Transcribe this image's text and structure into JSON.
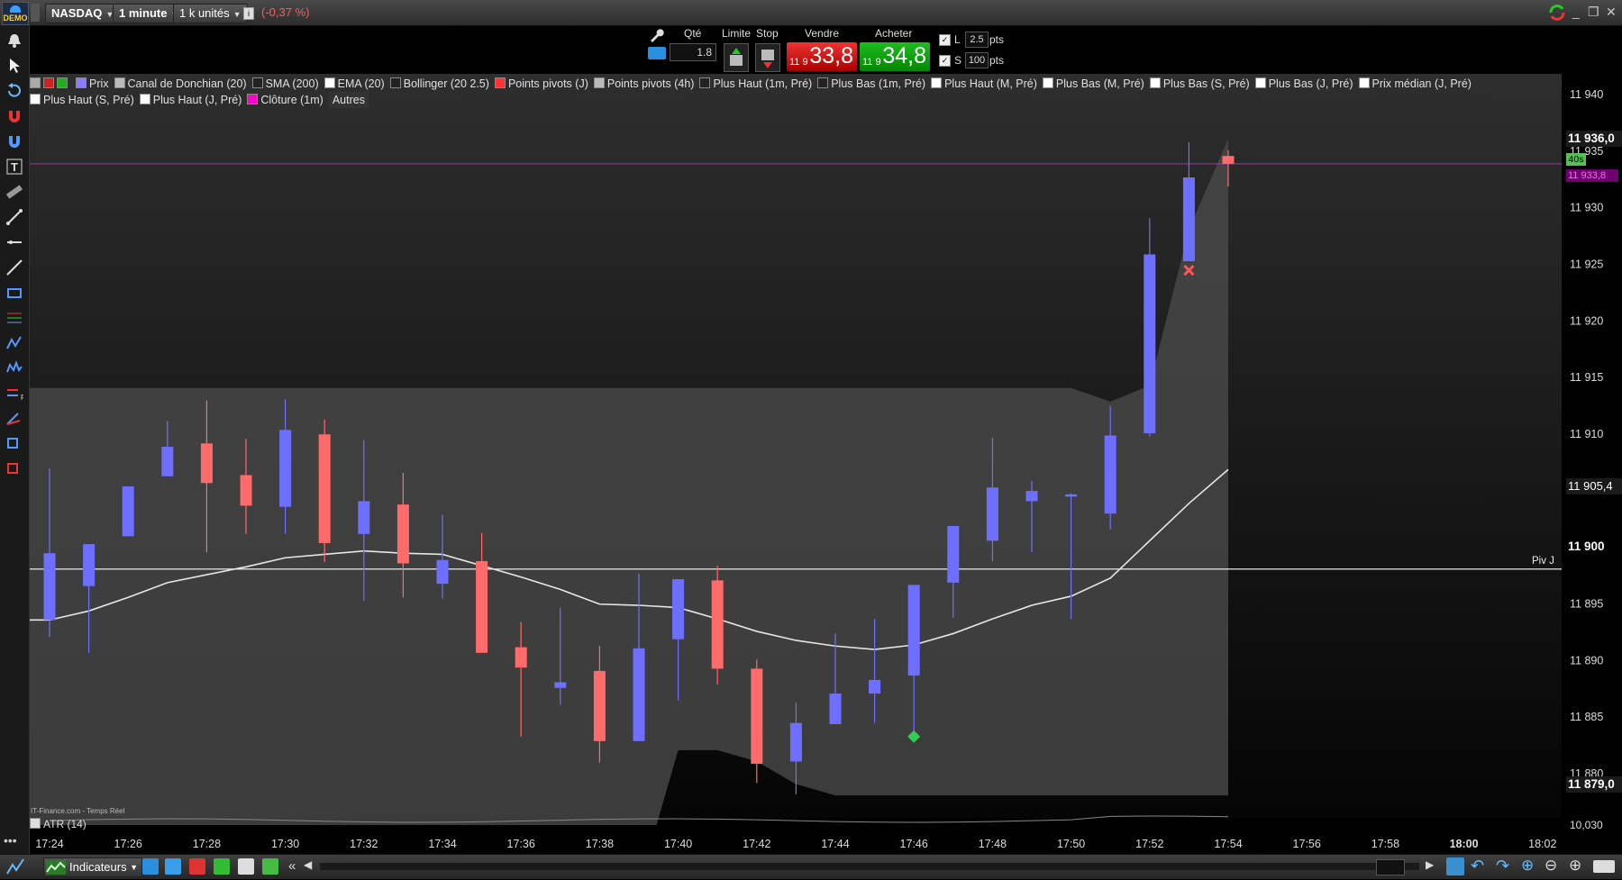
{
  "topbar": {
    "demo_label": "DEMO",
    "instrument": "NASDAQ",
    "timeframe": "1 minute",
    "units": "1 k unités",
    "change": "(-0,37 %)"
  },
  "order_panel": {
    "qty_label": "Qté",
    "qty_value": "1.8",
    "limit_label": "Limite",
    "stop_label": "Stop",
    "sell_label": "Vendre",
    "buy_label": "Acheter",
    "sell_prefix": "11 9",
    "sell_price": "33,8",
    "buy_prefix": "11 9",
    "buy_price": "34,8",
    "l_label": "L",
    "l_value": "2.5",
    "l_unit": "pts",
    "s_label": "S",
    "s_value": "100",
    "s_unit": "pts"
  },
  "legend": {
    "items": [
      {
        "label": "Prix",
        "color": "#8a7dff"
      },
      {
        "label": "Canal de Donchian (20)",
        "color": "#bbbbbb"
      },
      {
        "label": "SMA (200)",
        "color": "#222222"
      },
      {
        "label": "EMA (20)",
        "color": "#ffffff"
      },
      {
        "label": "Bollinger (20 2.5)",
        "color": "#222222"
      },
      {
        "label": "Points pivots (J)",
        "color": "#ff3333"
      },
      {
        "label": "Points pivots (4h)",
        "color": "#bbbbbb"
      },
      {
        "label": "Plus Haut (1m, Pré)",
        "color": "#222222"
      },
      {
        "label": "Plus Bas (1m, Pré)",
        "color": "#222222"
      },
      {
        "label": "Plus Haut (M, Pré)",
        "color": "#ffffff"
      },
      {
        "label": "Plus Bas (M, Pré)",
        "color": "#ffffff"
      },
      {
        "label": "Plus Bas (S, Pré)",
        "color": "#ffffff"
      },
      {
        "label": "Plus Bas (J, Pré)",
        "color": "#ffffff"
      },
      {
        "label": "Prix médian (J, Pré)",
        "color": "#ffffff"
      },
      {
        "label": "Plus Haut (S, Pré)",
        "color": "#ffffff"
      },
      {
        "label": "Plus Haut (J, Pré)",
        "color": "#ffffff"
      },
      {
        "label": "Clôture (1m)",
        "color": "#ff00cc"
      },
      {
        "label": "Autres",
        "color": ""
      }
    ]
  },
  "chart": {
    "source_label": "IT-Finance.com - Temps Réel",
    "pivot_label": "Piv J",
    "timer_label": "40s",
    "close_label": "11 933,8",
    "high_label": "11 936,0",
    "low_label": "11 879,0",
    "ema_label": "11 905,4",
    "pivot_price_label": "11 900",
    "atr_label": "ATR (14)",
    "atr_value": "10,030",
    "colors": {
      "up": "#6f6fff",
      "down": "#ff6a6a",
      "channel": "#4a4a4a",
      "ema": "#e6e6e6",
      "pivot": "#ffffff",
      "close_line": "#c020c0"
    }
  },
  "chart_data": {
    "type": "candlestick",
    "title": "NASDAQ 1 minute",
    "ylim": [
      11877,
      11942
    ],
    "y_ticks": [
      "11 940",
      "11 935",
      "11 930",
      "11 925",
      "11 920",
      "11 915",
      "11 910",
      "11 905",
      "11 895",
      "11 890",
      "11 885",
      "11 880"
    ],
    "x_ticks": [
      "17:24",
      "17:26",
      "17:28",
      "17:30",
      "17:32",
      "17:34",
      "17:36",
      "17:38",
      "17:40",
      "17:42",
      "17:44",
      "17:46",
      "17:48",
      "17:50",
      "17:52",
      "17:54",
      "17:56",
      "17:58",
      "18:00",
      "18:02"
    ],
    "candles": [
      {
        "t": "17:24",
        "o": 11893.5,
        "h": 11906.9,
        "l": 11892.0,
        "c": 11899.4
      },
      {
        "t": "17:25",
        "o": 11896.5,
        "h": 11899.3,
        "l": 11890.6,
        "c": 11900.2
      },
      {
        "t": "17:26",
        "o": 11900.9,
        "h": 11895.5,
        "l": 11903.0,
        "c": 11905.3
      },
      {
        "t": "17:27",
        "o": 11906.2,
        "h": 11911.1,
        "l": 11906.3,
        "c": 11908.8
      },
      {
        "t": "17:28",
        "o": 11909.1,
        "h": 11912.9,
        "l": 11899.5,
        "c": 11905.6
      },
      {
        "t": "17:29",
        "o": 11906.3,
        "h": 11909.5,
        "l": 11901.1,
        "c": 11903.6
      },
      {
        "t": "17:30",
        "o": 11903.5,
        "h": 11913.0,
        "l": 11901.1,
        "c": 11910.3
      },
      {
        "t": "17:31",
        "o": 11909.9,
        "h": 11911.2,
        "l": 11898.6,
        "c": 11900.3
      },
      {
        "t": "17:32",
        "o": 11901.1,
        "h": 11909.4,
        "l": 11895.2,
        "c": 11904.0
      },
      {
        "t": "17:33",
        "o": 11903.7,
        "h": 11906.5,
        "l": 11895.5,
        "c": 11898.5
      },
      {
        "t": "17:34",
        "o": 11896.7,
        "h": 11902.8,
        "l": 11895.4,
        "c": 11898.8
      },
      {
        "t": "17:35",
        "o": 11898.7,
        "h": 11901.2,
        "l": 11891.2,
        "c": 11890.6
      },
      {
        "t": "17:36",
        "o": 11891.1,
        "h": 11893.3,
        "l": 11883.2,
        "c": 11889.3
      },
      {
        "t": "17:37",
        "o": 11887.5,
        "h": 11894.6,
        "l": 11886.0,
        "c": 11888.0
      },
      {
        "t": "17:38",
        "o": 11889.0,
        "h": 11891.2,
        "l": 11880.9,
        "c": 11882.8
      },
      {
        "t": "17:39",
        "o": 11882.8,
        "h": 11897.6,
        "l": 11883.3,
        "c": 11891.0
      },
      {
        "t": "17:40",
        "o": 11891.8,
        "h": 11896.3,
        "l": 11886.4,
        "c": 11897.1
      },
      {
        "t": "17:41",
        "o": 11897.0,
        "h": 11898.3,
        "l": 11887.8,
        "c": 11889.2
      },
      {
        "t": "17:42",
        "o": 11889.2,
        "h": 11890.0,
        "l": 11879.1,
        "c": 11880.8
      },
      {
        "t": "17:43",
        "o": 11881.0,
        "h": 11886.2,
        "l": 11878.1,
        "c": 11884.4
      },
      {
        "t": "17:44",
        "o": 11884.3,
        "h": 11892.3,
        "l": 11884.5,
        "c": 11887.0
      },
      {
        "t": "17:45",
        "o": 11887.0,
        "h": 11893.6,
        "l": 11884.4,
        "c": 11888.2
      },
      {
        "t": "17:46",
        "o": 11888.6,
        "h": 11896.3,
        "l": 11883.1,
        "c": 11896.6
      },
      {
        "t": "17:47",
        "o": 11896.8,
        "h": 11901.3,
        "l": 11893.7,
        "c": 11901.8
      },
      {
        "t": "17:48",
        "o": 11900.5,
        "h": 11909.6,
        "l": 11898.7,
        "c": 11905.2
      },
      {
        "t": "17:49",
        "o": 11904.0,
        "h": 11905.8,
        "l": 11899.5,
        "c": 11904.9
      },
      {
        "t": "17:50",
        "o": 11904.4,
        "h": 11904.7,
        "l": 11893.6,
        "c": 11904.6
      },
      {
        "t": "17:51",
        "o": 11902.9,
        "h": 11912.4,
        "l": 11901.5,
        "c": 11909.8
      },
      {
        "t": "17:52",
        "o": 11910.0,
        "h": 11929.0,
        "l": 11909.7,
        "c": 11925.8
      },
      {
        "t": "17:53",
        "o": 11925.2,
        "h": 11935.7,
        "l": 11925.2,
        "c": 11932.6
      },
      {
        "t": "17:54",
        "o": 11934.5,
        "h": 11935.0,
        "l": 11931.8,
        "c": 11933.8
      }
    ],
    "ema": [
      11893.5,
      11894.3,
      11895.5,
      11896.8,
      11897.5,
      11898.2,
      11899.0,
      11899.3,
      11899.6,
      11899.4,
      11899.3,
      11898.3,
      11897.3,
      11896.2,
      11894.9,
      11894.8,
      11894.6,
      11893.6,
      11892.5,
      11891.7,
      11891.2,
      11890.9,
      11891.3,
      11892.3,
      11893.6,
      11894.8,
      11895.6,
      11897.2,
      11900.5,
      11903.8,
      11906.8
    ],
    "donchian_upper": [
      11914.0,
      11914.0,
      11914.0,
      11914.0,
      11914.0,
      11914.0,
      11914.0,
      11914.0,
      11914.0,
      11914.0,
      11914.0,
      11914.0,
      11914.0,
      11914.0,
      11914.0,
      11914.0,
      11914.0,
      11914.0,
      11914.0,
      11914.0,
      11914.0,
      11914.0,
      11914.0,
      11914.0,
      11914.0,
      11914.0,
      11914.0,
      11912.8,
      11914.2,
      11928.0,
      11936.0
    ],
    "donchian_lower": [
      11870.0,
      11870.0,
      11870.0,
      11870.0,
      11870.0,
      11870.0,
      11870.0,
      11870.0,
      11870.0,
      11870.0,
      11870.0,
      11870.0,
      11870.0,
      11870.0,
      11870.0,
      11870.0,
      11882.0,
      11882.0,
      11881.0,
      11879.0,
      11878.0,
      11878.0,
      11878.0,
      11878.0,
      11878.0,
      11878.0,
      11878.0,
      11878.0,
      11878.0,
      11878.0,
      11878.0
    ],
    "pivot_j": 11898.0,
    "close_line": 11933.8
  }
}
